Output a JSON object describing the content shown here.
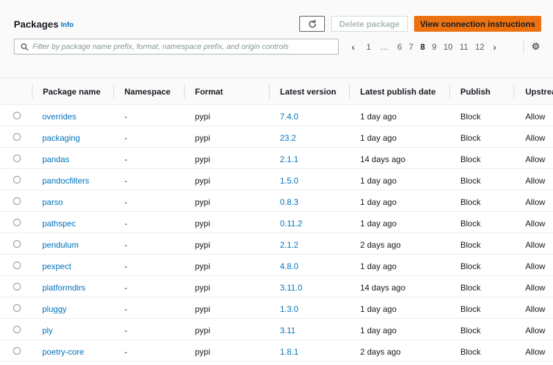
{
  "header": {
    "title": "Packages",
    "info": "Info",
    "delete_label": "Delete package",
    "primary_label": "View connection instructions"
  },
  "search": {
    "placeholder": "Filter by package name prefix, format, namespace prefix, and origin controls"
  },
  "pagination": {
    "pages": [
      "1",
      "...",
      "6",
      "7",
      "8",
      "9",
      "10",
      "11",
      "12"
    ],
    "current": "8"
  },
  "table": {
    "columns": [
      "Package name",
      "Namespace",
      "Format",
      "Latest version",
      "Latest publish date",
      "Publish",
      "Upstream"
    ],
    "rows": [
      {
        "name": "overrides",
        "namespace": "-",
        "format": "pypi",
        "version": "7.4.0",
        "date": "1 day ago",
        "publish": "Block",
        "upstream": "Allow"
      },
      {
        "name": "packaging",
        "namespace": "-",
        "format": "pypi",
        "version": "23.2",
        "date": "1 day ago",
        "publish": "Block",
        "upstream": "Allow"
      },
      {
        "name": "pandas",
        "namespace": "-",
        "format": "pypi",
        "version": "2.1.1",
        "date": "14 days ago",
        "publish": "Block",
        "upstream": "Allow"
      },
      {
        "name": "pandocfilters",
        "namespace": "-",
        "format": "pypi",
        "version": "1.5.0",
        "date": "1 day ago",
        "publish": "Block",
        "upstream": "Allow"
      },
      {
        "name": "parso",
        "namespace": "-",
        "format": "pypi",
        "version": "0.8.3",
        "date": "1 day ago",
        "publish": "Block",
        "upstream": "Allow"
      },
      {
        "name": "pathspec",
        "namespace": "-",
        "format": "pypi",
        "version": "0.11.2",
        "date": "1 day ago",
        "publish": "Block",
        "upstream": "Allow"
      },
      {
        "name": "pendulum",
        "namespace": "-",
        "format": "pypi",
        "version": "2.1.2",
        "date": "2 days ago",
        "publish": "Block",
        "upstream": "Allow"
      },
      {
        "name": "pexpect",
        "namespace": "-",
        "format": "pypi",
        "version": "4.8.0",
        "date": "1 day ago",
        "publish": "Block",
        "upstream": "Allow"
      },
      {
        "name": "platformdirs",
        "namespace": "-",
        "format": "pypi",
        "version": "3.11.0",
        "date": "14 days ago",
        "publish": "Block",
        "upstream": "Allow"
      },
      {
        "name": "pluggy",
        "namespace": "-",
        "format": "pypi",
        "version": "1.3.0",
        "date": "1 day ago",
        "publish": "Block",
        "upstream": "Allow"
      },
      {
        "name": "ply",
        "namespace": "-",
        "format": "pypi",
        "version": "3.11",
        "date": "1 day ago",
        "publish": "Block",
        "upstream": "Allow"
      },
      {
        "name": "poetry-core",
        "namespace": "-",
        "format": "pypi",
        "version": "1.8.1",
        "date": "2 days ago",
        "publish": "Block",
        "upstream": "Allow"
      }
    ]
  },
  "colors": {
    "link": "#0073bb",
    "primary": "#ec7211",
    "border": "#eaeded"
  }
}
